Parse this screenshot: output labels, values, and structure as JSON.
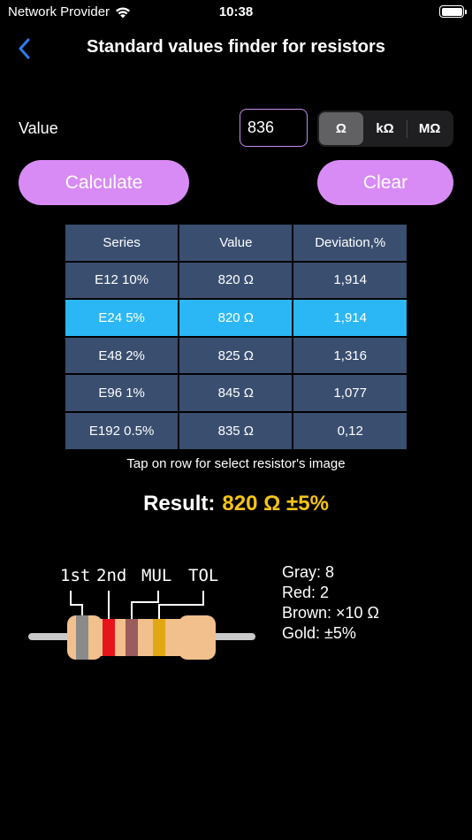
{
  "status_bar": {
    "carrier": "Network Provider",
    "time": "10:38"
  },
  "nav": {
    "title": "Standard values finder for resistors"
  },
  "input": {
    "label": "Value",
    "value": "836",
    "units": [
      "Ω",
      "kΩ",
      "MΩ"
    ],
    "selected_unit": "Ω"
  },
  "buttons": {
    "calculate": "Calculate",
    "clear": "Clear"
  },
  "table": {
    "headers": [
      "Series",
      "Value",
      "Deviation,%"
    ],
    "rows": [
      {
        "series": "E12 10%",
        "value": "820 Ω",
        "deviation": "1,914",
        "selected": false
      },
      {
        "series": "E24 5%",
        "value": "820 Ω",
        "deviation": "1,914",
        "selected": true
      },
      {
        "series": "E48 2%",
        "value": "825 Ω",
        "deviation": "1,316",
        "selected": false
      },
      {
        "series": "E96 1%",
        "value": "845 Ω",
        "deviation": "1,077",
        "selected": false
      },
      {
        "series": "E192 0.5%",
        "value": "835 Ω",
        "deviation": "0,12",
        "selected": false
      }
    ]
  },
  "hint": "Tap on row for select resistor's image",
  "result": {
    "label": "Result:",
    "value": "820 Ω ±5%"
  },
  "resistor": {
    "band_labels": [
      "1st",
      "2nd",
      "MUL",
      "TOL"
    ],
    "band_colors": [
      "#8a8a8a",
      "#e8141c",
      "#9a5c5c",
      "#e0a812"
    ],
    "legend": [
      "Gray: 8",
      "Red: 2",
      "Brown: ×10 Ω",
      "Gold: ±5%"
    ]
  },
  "colors": {
    "accent_button": "#d88bf5",
    "table_cell": "#3a4f70",
    "table_selected": "#2bb7f5",
    "result_value": "#f5c416",
    "back_chevron": "#2f7cf6"
  }
}
